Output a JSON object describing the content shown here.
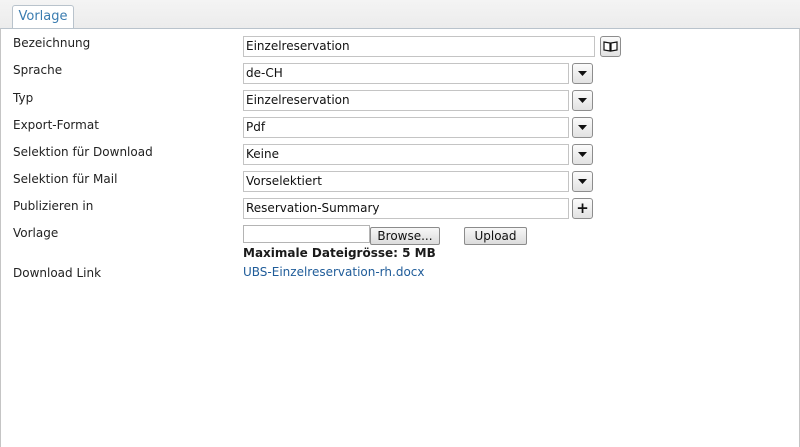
{
  "tab": {
    "label": "Vorlage"
  },
  "form": {
    "bezeichnung": {
      "label": "Bezeichnung",
      "value": "Einzelreservation",
      "icon": "book-icon"
    },
    "sprache": {
      "label": "Sprache",
      "value": "de-CH"
    },
    "typ": {
      "label": "Typ",
      "value": "Einzelreservation"
    },
    "export_format": {
      "label": "Export-Format",
      "value": "Pdf"
    },
    "selektion_download": {
      "label": "Selektion für Download",
      "value": "Keine"
    },
    "selektion_mail": {
      "label": "Selektion für Mail",
      "value": "Vorselektiert"
    },
    "publizieren": {
      "label": "Publizieren in",
      "value": "Reservation-Summary",
      "add_label": "+"
    },
    "vorlage": {
      "label": "Vorlage",
      "browse_label": "Browse...",
      "upload_label": "Upload",
      "max_size_text": "Maximale Dateigrösse: 5 MB"
    },
    "download": {
      "label": "Download Link",
      "link_text": "UBS-Einzelreservation-rh.docx"
    }
  },
  "colors": {
    "tab_text": "#3a7cb0",
    "link": "#1f5c99"
  }
}
